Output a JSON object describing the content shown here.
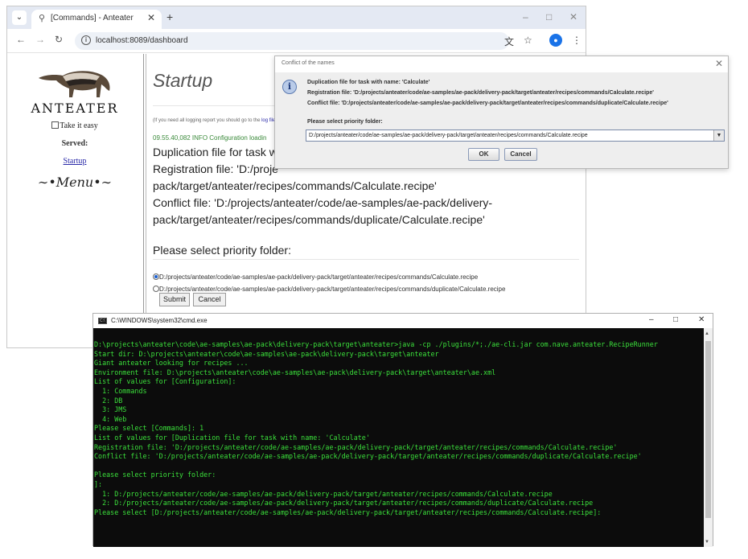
{
  "browser": {
    "tab_title": "[Commands] - Anteater",
    "url": "localhost:8089/dashboard"
  },
  "sidebar": {
    "logo_text": "ANTEATER",
    "take_it_easy": "Take it easy",
    "served": "Served:",
    "startup_link": "Startup",
    "menu_title": "Menu"
  },
  "content": {
    "title": "Startup",
    "log_note": "(If you need all logging report you should go to the ",
    "log_note_link": "log file",
    "log_line": "09.55.40,082 INFO Configuration loadin",
    "text_lines": [
      "Duplication file for task w",
      "Registration file: 'D:/proje",
      "pack/target/anteater/recipes/commands/Calculate.recipe'",
      "Conflict file: 'D:/projects/anteater/code/ae-samples/ae-pack/delivery-",
      "pack/target/anteater/recipes/commands/duplicate/Calculate.recipe'"
    ],
    "priority_label": "Please select priority folder:",
    "options": [
      "D:/projects/anteater/code/ae-samples/ae-pack/delivery-pack/target/anteater/recipes/commands/Calculate.recipe",
      "D:/projects/anteater/code/ae-samples/ae-pack/delivery-pack/target/anteater/recipes/commands/duplicate/Calculate.recipe"
    ],
    "submit": "Submit",
    "cancel": "Cancel"
  },
  "dialog": {
    "title": "Conflict of the names",
    "line1": "Duplication file for task with name: 'Calculate'",
    "line2": "Registration file: 'D:/projects/anteater/code/ae-samples/ae-pack/delivery-pack/target/anteater/recipes/commands/Calculate.recipe'",
    "line3": "Conflict file: 'D:/projects/anteater/code/ae-samples/ae-pack/delivery-pack/target/anteater/recipes/commands/duplicate/Calculate.recipe'",
    "select_label": "Please select priority folder:",
    "selected": "D:/projects/anteater/code/ae-samples/ae-pack/delivery-pack/target/anteater/recipes/commands/Calculate.recipe",
    "ok": "OK",
    "cancel": "Cancel"
  },
  "cmd": {
    "title": "C:\\WINDOWS\\system32\\cmd.exe",
    "lines": [
      "D:\\projects\\anteater\\code\\ae-samples\\ae-pack\\delivery-pack\\target\\anteater>java -cp ./plugins/*;./ae-cli.jar com.nave.anteater.RecipeRunner",
      "Start dir: D:\\projects\\anteater\\code\\ae-samples\\ae-pack\\delivery-pack\\target\\anteater",
      "Giant anteater looking for recipes ...",
      "Environment file: D:\\projects\\anteater\\code\\ae-samples\\ae-pack\\delivery-pack\\target\\anteater\\ae.xml",
      "List of values for [Configuration]:",
      "  1: Commands",
      "  2: DB",
      "  3: JMS",
      "  4: Web",
      "Please select [Commands]: 1",
      "List of values for [Duplication file for task with name: 'Calculate'",
      "Registration file: 'D:/projects/anteater/code/ae-samples/ae-pack/delivery-pack/target/anteater/recipes/commands/Calculate.recipe'",
      "Conflict file: 'D:/projects/anteater/code/ae-samples/ae-pack/delivery-pack/target/anteater/recipes/commands/duplicate/Calculate.recipe'",
      "",
      "Please select priority folder:",
      "]:",
      "  1: D:/projects/anteater/code/ae-samples/ae-pack/delivery-pack/target/anteater/recipes/commands/Calculate.recipe",
      "  2: D:/projects/anteater/code/ae-samples/ae-pack/delivery-pack/target/anteater/recipes/commands/duplicate/Calculate.recipe",
      "Please select [D:/projects/anteater/code/ae-samples/ae-pack/delivery-pack/target/anteater/recipes/commands/Calculate.recipe]:"
    ]
  },
  "colors": {
    "terminal_text": "#3be03b",
    "terminal_bg": "#0c0c0c",
    "link": "#2a2aa8",
    "log_green": "#3a8a3a"
  }
}
